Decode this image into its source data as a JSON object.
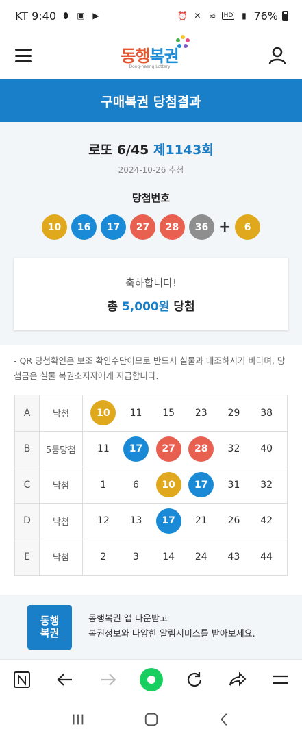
{
  "status": {
    "carrier_time": "KT 9:40",
    "battery": "76%"
  },
  "app": {
    "logo_part1": "동행",
    "logo_part2": "복권",
    "logo_sub": "Dong-haeng Lottery"
  },
  "band": {
    "title": "구매복권 당첨결과"
  },
  "result": {
    "game": "로또 6/45",
    "draw": "제1143회",
    "date": "2024-10-26 추첨",
    "label": "당첨번호",
    "numbers": [
      {
        "v": "10",
        "color": "#e0a81c"
      },
      {
        "v": "16",
        "color": "#1a8ad6"
      },
      {
        "v": "17",
        "color": "#1a8ad6"
      },
      {
        "v": "27",
        "color": "#e8604f"
      },
      {
        "v": "28",
        "color": "#e8604f"
      },
      {
        "v": "36",
        "color": "#8e8e8e"
      }
    ],
    "plus": "+",
    "bonus": {
      "v": "6",
      "color": "#e0a81c"
    },
    "congrats": "축하합니다!",
    "total_prefix": "총",
    "total_amount": "5,000원",
    "total_suffix": "당첨"
  },
  "notice": "- QR 당첨확인은 보조 확인수단이므로 반드시 실물과 대조하시기 바라며, 당첨금은 실물 복권소지자에게 지급합니다.",
  "rows": [
    {
      "key": "A",
      "status": "낙첨",
      "nums": [
        [
          "10",
          "#e0a81c"
        ],
        [
          "11",
          ""
        ],
        [
          "15",
          ""
        ],
        [
          "23",
          ""
        ],
        [
          "29",
          ""
        ],
        [
          "38",
          ""
        ]
      ]
    },
    {
      "key": "B",
      "status": "5등당첨",
      "nums": [
        [
          "11",
          ""
        ],
        [
          "17",
          "#1a8ad6"
        ],
        [
          "27",
          "#e8604f"
        ],
        [
          "28",
          "#e8604f"
        ],
        [
          "32",
          ""
        ],
        [
          "40",
          ""
        ]
      ]
    },
    {
      "key": "C",
      "status": "낙첨",
      "nums": [
        [
          "1",
          ""
        ],
        [
          "6",
          ""
        ],
        [
          "10",
          "#e0a81c"
        ],
        [
          "17",
          "#1a8ad6"
        ],
        [
          "31",
          ""
        ],
        [
          "32",
          ""
        ]
      ]
    },
    {
      "key": "D",
      "status": "낙첨",
      "nums": [
        [
          "12",
          ""
        ],
        [
          "13",
          ""
        ],
        [
          "17",
          "#1a8ad6"
        ],
        [
          "21",
          ""
        ],
        [
          "26",
          ""
        ],
        [
          "42",
          ""
        ]
      ]
    },
    {
      "key": "E",
      "status": "낙첨",
      "nums": [
        [
          "2",
          ""
        ],
        [
          "3",
          ""
        ],
        [
          "14",
          ""
        ],
        [
          "24",
          ""
        ],
        [
          "43",
          ""
        ],
        [
          "44",
          ""
        ]
      ]
    }
  ],
  "promo": {
    "logo_line1": "동행",
    "logo_line2": "복권",
    "line1": "동행복권 앱 다운받고",
    "line2": "복권정보와 다양한 알림서비스를 받아보세요."
  },
  "toolbar": {
    "icons": [
      "n-icon",
      "back-arrow-icon",
      "forward-arrow-icon",
      "home-dot-icon",
      "refresh-icon",
      "share-icon",
      "menu-icon"
    ]
  }
}
